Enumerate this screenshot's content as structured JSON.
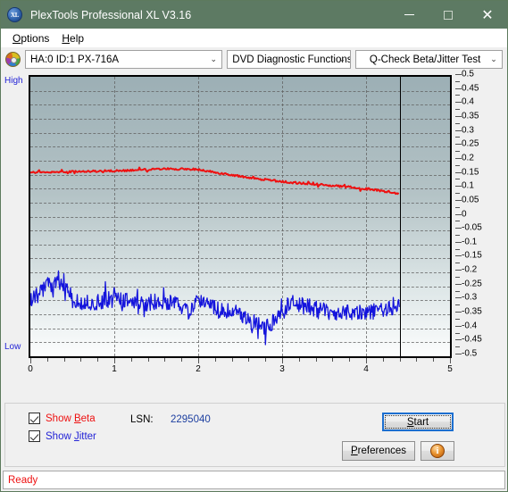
{
  "window": {
    "title": "PlexTools Professional XL V3.16",
    "icon": "xl-logo-icon",
    "minimize": "minimize-icon",
    "maximize": "maximize-icon",
    "close": "✕"
  },
  "menubar": {
    "items": [
      {
        "label": "Options",
        "mnemonic": "O"
      },
      {
        "label": "Help",
        "mnemonic": "H"
      }
    ]
  },
  "toolbar": {
    "drive_icon": "disc-icon",
    "drive": "HA:0 ID:1  PX-716A",
    "function": "DVD Diagnostic Functions",
    "test": "Q-Check Beta/Jitter Test",
    "arrow": "⌄"
  },
  "controls": {
    "show_beta": "Show Beta",
    "show_jitter": "Show Jitter",
    "lsn_label": "LSN:",
    "lsn_value": "2295040",
    "start": "Start",
    "preferences": "Preferences",
    "info": "i"
  },
  "status": {
    "text": "Ready"
  },
  "chart_data": {
    "type": "line",
    "title": "Q-Check Beta/Jitter Test",
    "xlabel": "",
    "ylabel": "",
    "xlim": [
      0,
      5
    ],
    "ylim": [
      -0.5,
      0.5
    ],
    "grid": true,
    "legend": "none",
    "x_ticks": [
      "0",
      "1",
      "2",
      "3",
      "4",
      "5"
    ],
    "y_ticks": [
      "0.5",
      "0.45",
      "0.4",
      "0.35",
      "0.3",
      "0.25",
      "0.2",
      "0.15",
      "0.1",
      "0.05",
      "0",
      "-0.05",
      "-0.1",
      "-0.15",
      "-0.2",
      "-0.25",
      "-0.3",
      "-0.35",
      "-0.4",
      "-0.45",
      "-0.5"
    ],
    "left_top_label": "High",
    "left_bottom_label": "Low",
    "data_end_x": 4.4,
    "colors": {
      "beta": "#ee1111",
      "jitter": "#1414dc",
      "plot_top": "#9cafb5",
      "plot_bottom": "#fcfdfd"
    },
    "series": [
      {
        "name": "Beta",
        "color": "#ee1111",
        "x": [
          0.0,
          0.15,
          0.3,
          0.45,
          0.6,
          0.8,
          1.0,
          1.2,
          1.4,
          1.6,
          1.8,
          1.95,
          2.05,
          2.2,
          2.4,
          2.55,
          2.7,
          2.85,
          3.0,
          3.15,
          3.3,
          3.5,
          3.7,
          3.9,
          4.1,
          4.25,
          4.4
        ],
        "values": [
          0.158,
          0.16,
          0.159,
          0.161,
          0.16,
          0.163,
          0.163,
          0.166,
          0.168,
          0.17,
          0.17,
          0.169,
          0.165,
          0.158,
          0.149,
          0.142,
          0.134,
          0.13,
          0.125,
          0.121,
          0.118,
          0.113,
          0.108,
          0.103,
          0.096,
          0.089,
          0.082
        ]
      },
      {
        "name": "Jitter",
        "color": "#1414dc",
        "x": [
          0.0,
          0.1,
          0.2,
          0.3,
          0.4,
          0.55,
          0.7,
          0.85,
          1.0,
          1.15,
          1.3,
          1.45,
          1.6,
          1.75,
          1.9,
          2.0,
          2.1,
          2.25,
          2.4,
          2.55,
          2.7,
          2.85,
          3.0,
          3.1,
          3.25,
          3.4,
          3.55,
          3.7,
          3.85,
          4.0,
          4.15,
          4.3,
          4.4
        ],
        "values": [
          -0.3,
          -0.268,
          -0.245,
          -0.24,
          -0.255,
          -0.3,
          -0.31,
          -0.3,
          -0.295,
          -0.3,
          -0.315,
          -0.305,
          -0.3,
          -0.32,
          -0.345,
          -0.3,
          -0.32,
          -0.335,
          -0.34,
          -0.36,
          -0.385,
          -0.395,
          -0.33,
          -0.31,
          -0.32,
          -0.33,
          -0.34,
          -0.345,
          -0.345,
          -0.34,
          -0.338,
          -0.33,
          -0.315
        ]
      }
    ]
  }
}
